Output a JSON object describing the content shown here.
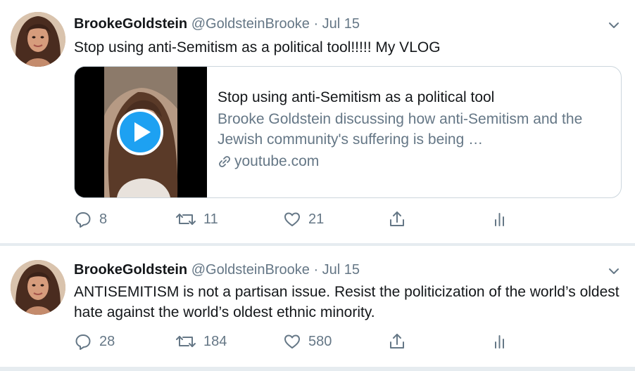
{
  "tweets": [
    {
      "author_name": "BrookeGoldstein",
      "handle": "@GoldsteinBrooke",
      "separator": "·",
      "date": "Jul 15",
      "text": "Stop using anti-Semitism as a political tool!!!!! My VLOG",
      "card": {
        "title": "Stop using anti-Semitism as a political tool",
        "description": "Brooke Goldstein discussing how anti-Semitism and the Jewish community's suffering is being …",
        "domain": "youtube.com",
        "play_icon": "play-icon",
        "link_icon": "link-icon"
      },
      "actions": {
        "replies": "8",
        "retweets": "11",
        "likes": "21"
      }
    },
    {
      "author_name": "BrookeGoldstein",
      "handle": "@GoldsteinBrooke",
      "separator": "·",
      "date": "Jul 15",
      "text": "ANTISEMITISM is not a partisan issue. Resist the politicization of the world’s oldest hate against the world’s oldest ethnic minority.",
      "actions": {
        "replies": "28",
        "retweets": "184",
        "likes": "580"
      }
    }
  ],
  "colors": {
    "text": "#14171a",
    "secondary": "#657786",
    "border": "#ccd6dd",
    "separator": "#e6ecf0",
    "play_blue": "#1da1f2"
  },
  "icons": [
    "reply-icon",
    "retweet-icon",
    "like-icon",
    "share-icon",
    "analytics-icon",
    "chevron-down-icon"
  ]
}
